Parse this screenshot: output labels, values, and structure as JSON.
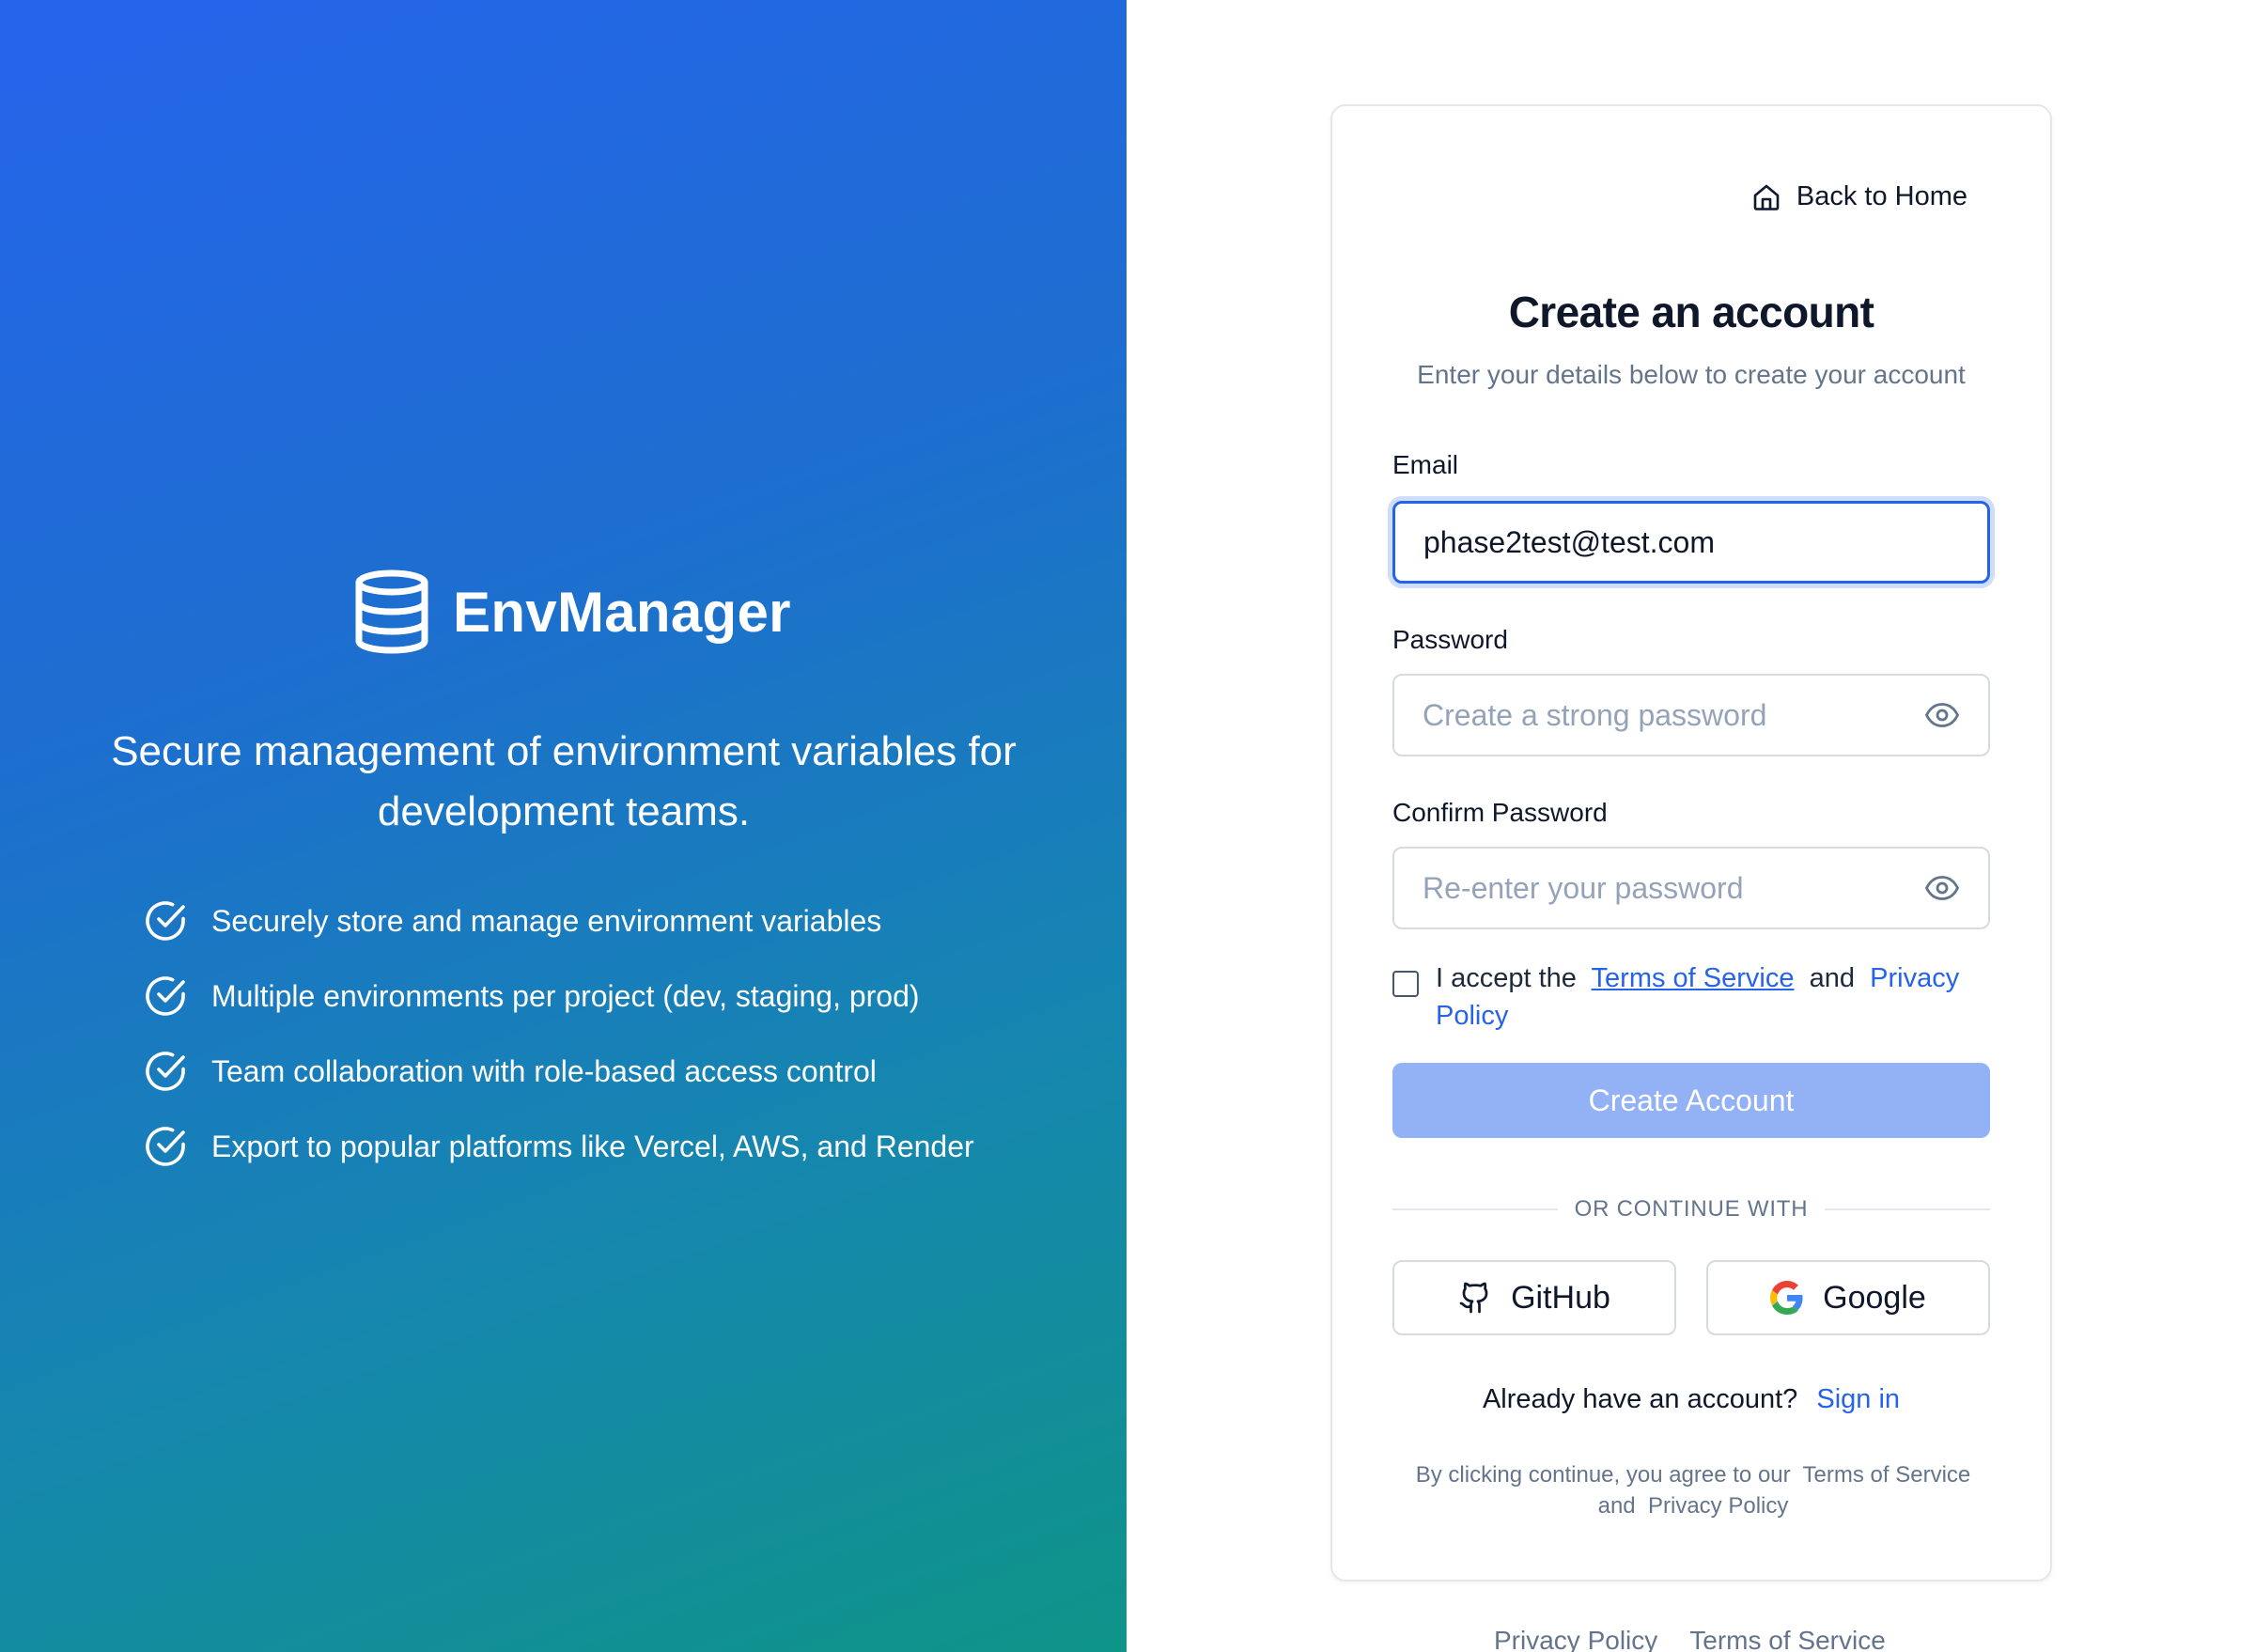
{
  "hero": {
    "brand_name": "EnvManager",
    "brand_icon": "database-icon",
    "tagline": "Secure management of environment variables for development teams.",
    "features": [
      "Securely store and manage environment variables",
      "Multiple environments per project (dev, staging, prod)",
      "Team collaboration with role-based access control",
      "Export to popular platforms like Vercel, AWS, and Render"
    ],
    "colors": {
      "gradient_start": "#2563eb",
      "gradient_end": "#0f9488"
    }
  },
  "card": {
    "back_link": "Back to Home",
    "title": "Create an account",
    "subtitle": "Enter your details below to create your account",
    "email": {
      "label": "Email",
      "value": "phase2test@test.com"
    },
    "password": {
      "label": "Password",
      "placeholder": "Create a strong password"
    },
    "confirm_password": {
      "label": "Confirm Password",
      "placeholder": "Re-enter your password"
    },
    "terms": {
      "checked": false,
      "prefix": "I accept the",
      "tos_link": "Terms of Service",
      "and": "and",
      "privacy_link": "Privacy Policy"
    },
    "submit_label": "Create Account",
    "divider_text": "OR CONTINUE WITH",
    "github_label": "GitHub",
    "google_label": "Google",
    "signin_prompt": "Already have an account?",
    "signin_link": "Sign in",
    "fineprint": {
      "prefix": "By clicking continue, you agree to our",
      "tos": "Terms of Service",
      "and": "and",
      "privacy": "Privacy Policy"
    }
  },
  "footer": {
    "privacy": "Privacy Policy",
    "terms": "Terms of Service"
  },
  "colors": {
    "accent": "#2563eb",
    "button_disabled": "#93b1f5",
    "muted": "#64748b"
  }
}
